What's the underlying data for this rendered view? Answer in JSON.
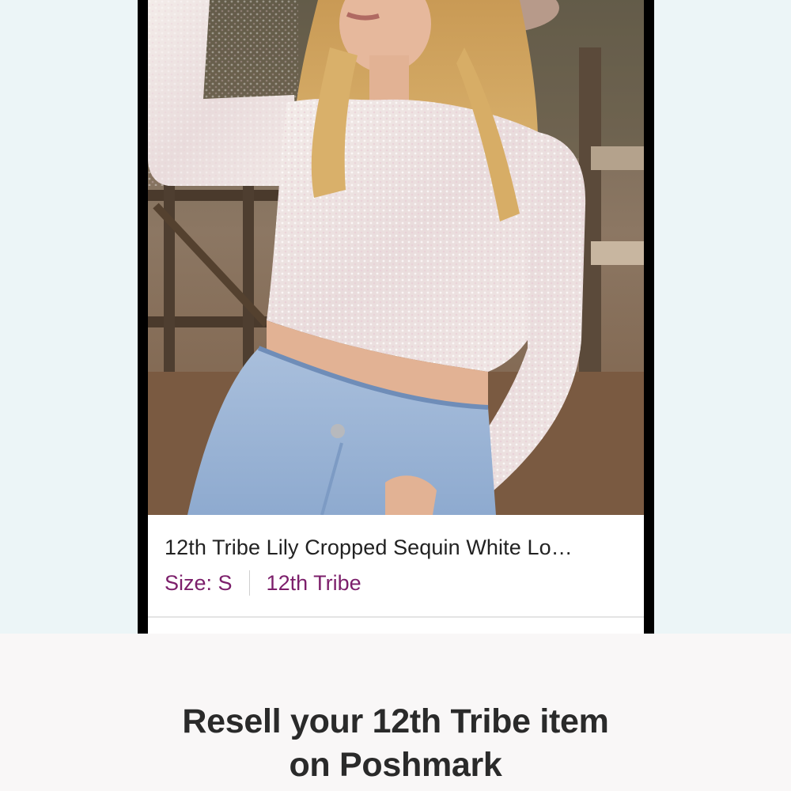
{
  "listing": {
    "title": "12th Tribe Lily Cropped Sequin White Lo…",
    "size": "Size: S",
    "brand": "12th Tribe",
    "photo": "product-photo"
  },
  "promo": {
    "line1": "Resell your 12th Tribe item",
    "line2": "on Poshmark"
  },
  "colors": {
    "background": "#ecf5f7",
    "accent": "#7c1f6b",
    "panel": "#f9f7f7"
  }
}
